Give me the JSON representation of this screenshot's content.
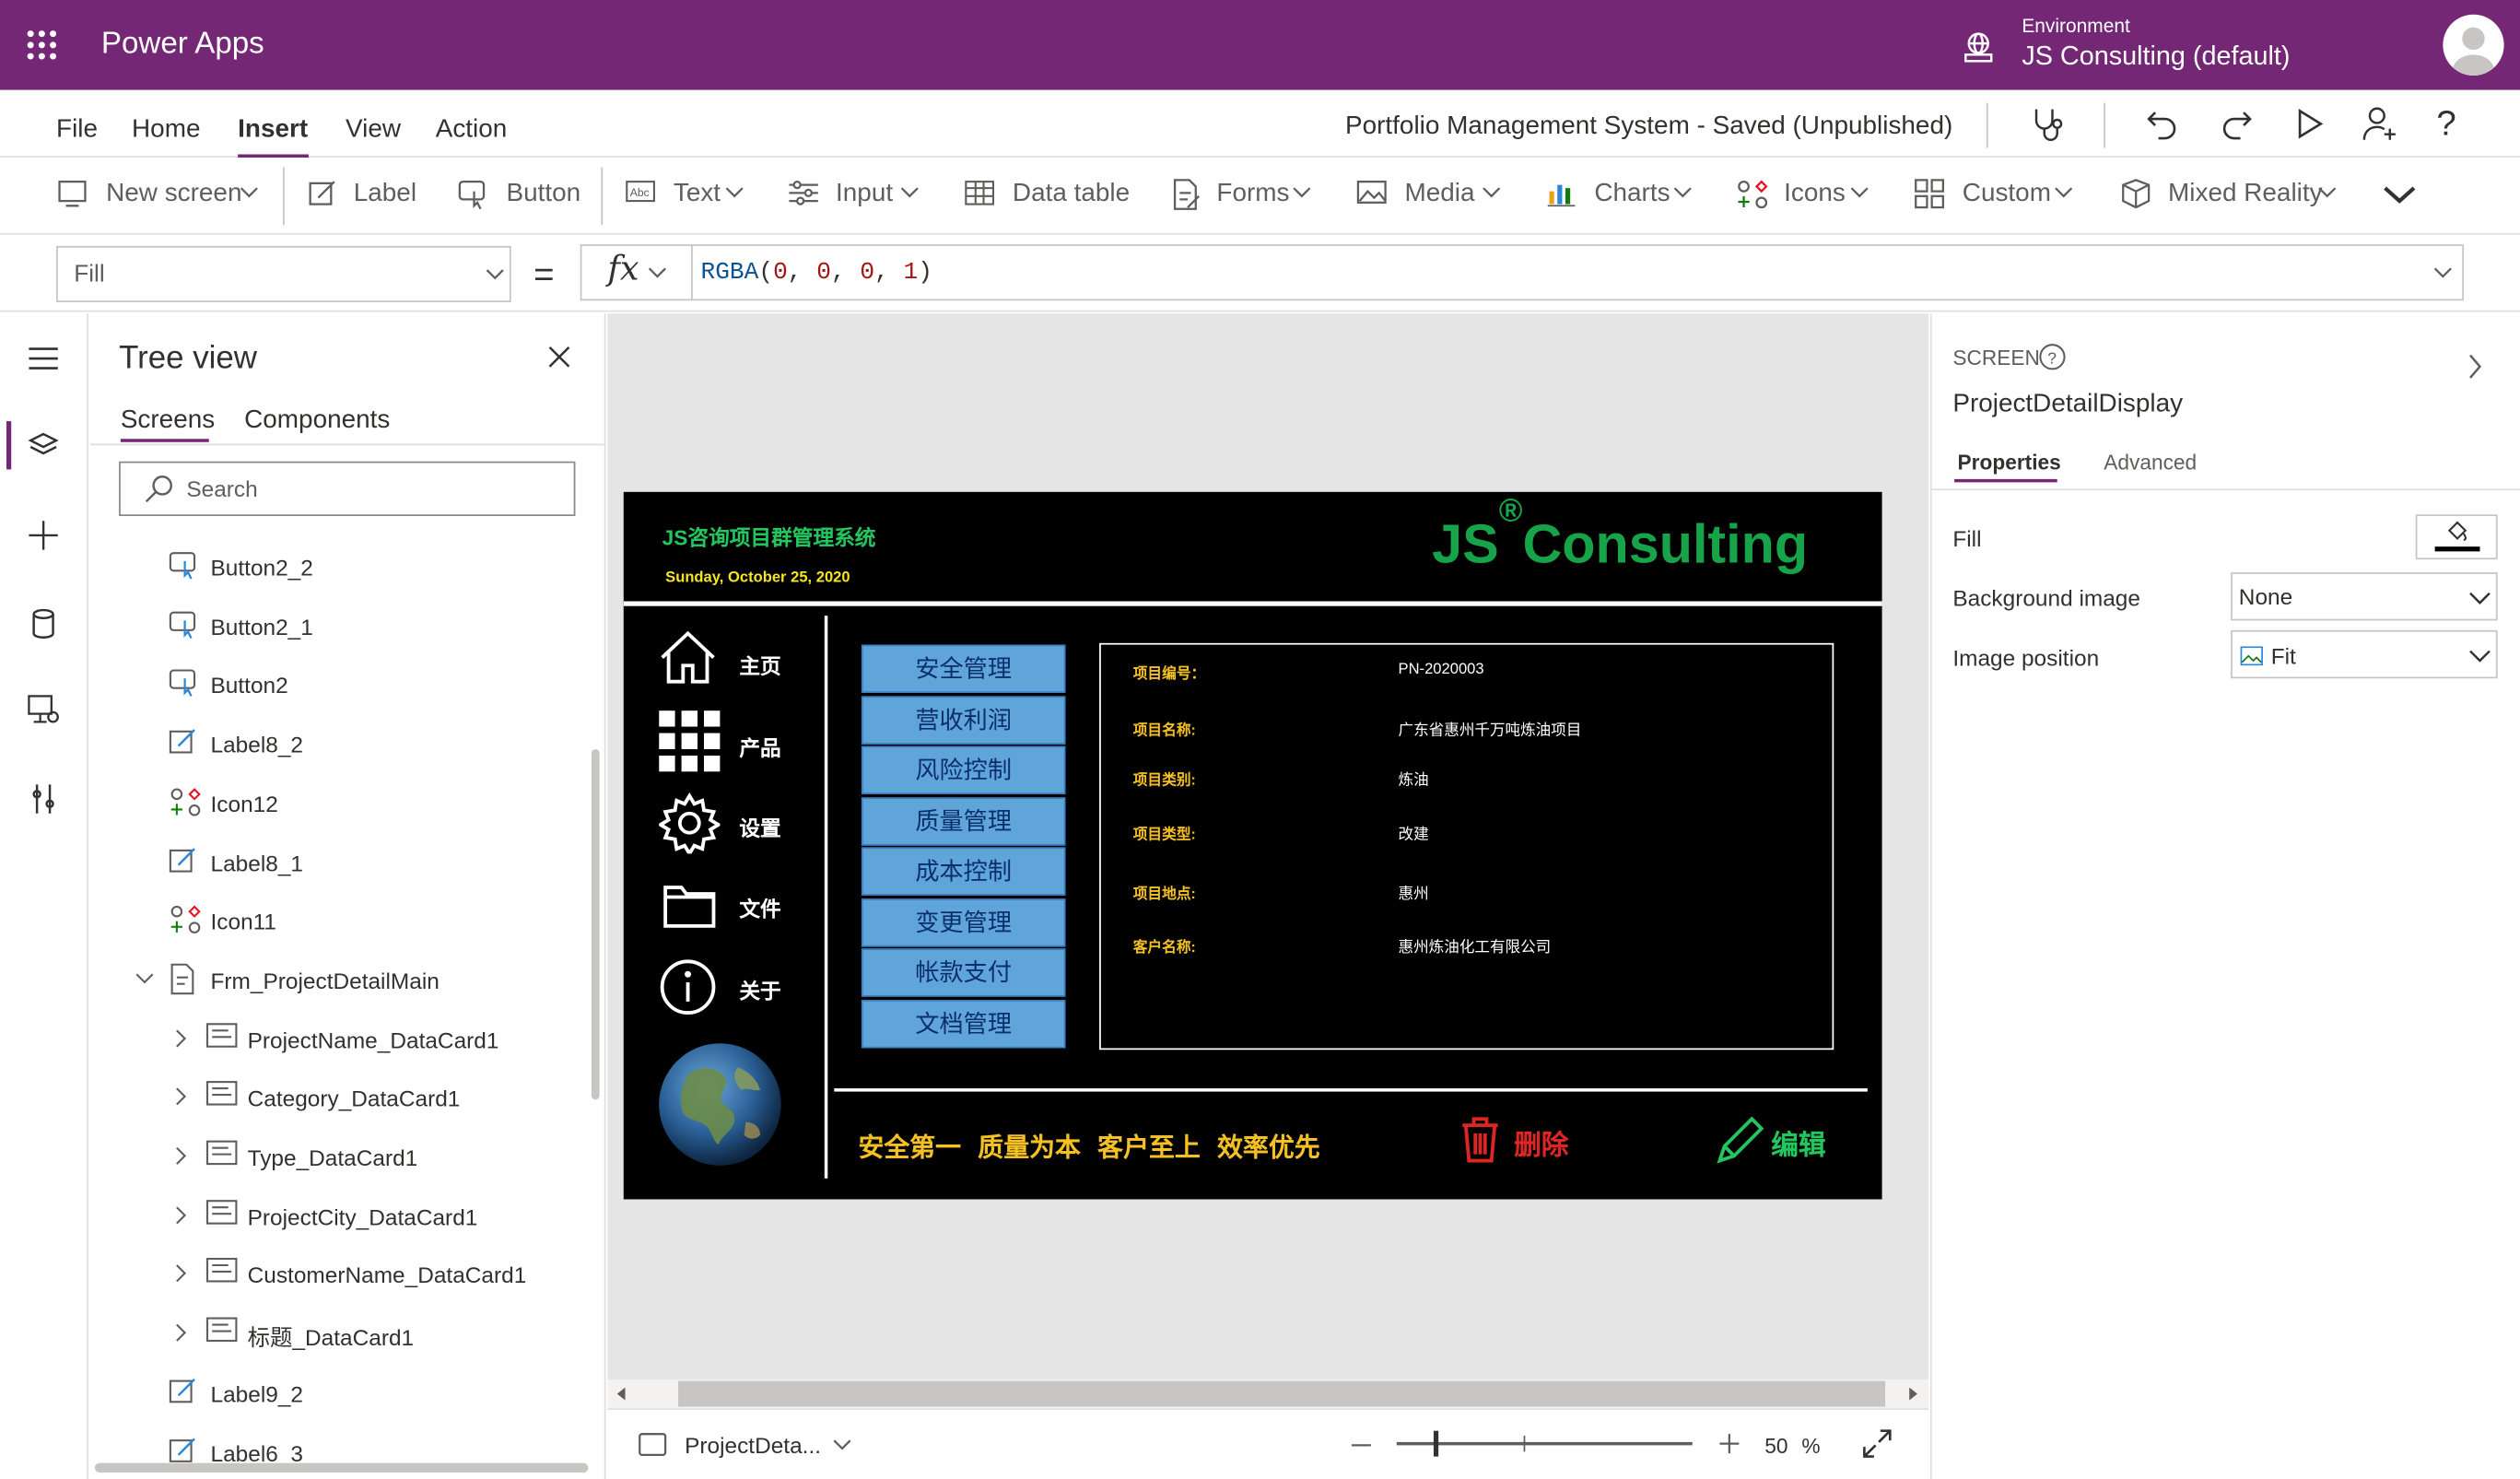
{
  "header": {
    "app_name": "Power Apps",
    "environment_label": "Environment",
    "environment_name": "JS Consulting (default)"
  },
  "menu": {
    "items": [
      "File",
      "Home",
      "Insert",
      "View",
      "Action"
    ],
    "active": "Insert",
    "document_title": "Portfolio Management System - Saved (Unpublished)"
  },
  "ribbon": {
    "new_screen": "New screen",
    "label": "Label",
    "button": "Button",
    "text": "Text",
    "input": "Input",
    "data_table": "Data table",
    "forms": "Forms",
    "media": "Media",
    "charts": "Charts",
    "icons": "Icons",
    "custom": "Custom",
    "mixed_reality": "Mixed Reality"
  },
  "formula_bar": {
    "property": "Fill",
    "equals": "=",
    "fx": "fx",
    "fn": "RGBA",
    "args": [
      "0",
      "0",
      "0",
      "1"
    ]
  },
  "tree_view": {
    "title": "Tree view",
    "tabs": [
      "Screens",
      "Components"
    ],
    "search_placeholder": "Search",
    "items": [
      {
        "label": "Button2_2",
        "icon": "button-icon",
        "indent": 1
      },
      {
        "label": "Button2_1",
        "icon": "button-icon",
        "indent": 1
      },
      {
        "label": "Button2",
        "icon": "button-icon",
        "indent": 1
      },
      {
        "label": "Label8_2",
        "icon": "label-icon",
        "indent": 1
      },
      {
        "label": "Icon12",
        "icon": "icon-control-icon",
        "indent": 1
      },
      {
        "label": "Label8_1",
        "icon": "label-icon",
        "indent": 1
      },
      {
        "label": "Icon11",
        "icon": "icon-control-icon",
        "indent": 1
      },
      {
        "label": "Frm_ProjectDetailMain",
        "icon": "form-icon",
        "indent": 1,
        "expanded": true
      },
      {
        "label": "ProjectName_DataCard1",
        "icon": "datacard-icon",
        "indent": 2
      },
      {
        "label": "Category_DataCard1",
        "icon": "datacard-icon",
        "indent": 2
      },
      {
        "label": "Type_DataCard1",
        "icon": "datacard-icon",
        "indent": 2
      },
      {
        "label": "ProjectCity_DataCard1",
        "icon": "datacard-icon",
        "indent": 2
      },
      {
        "label": "CustomerName_DataCard1",
        "icon": "datacard-icon",
        "indent": 2
      },
      {
        "label": "标题_DataCard1",
        "icon": "datacard-icon",
        "indent": 2
      },
      {
        "label": "Label9_2",
        "icon": "label-icon",
        "indent": 1
      },
      {
        "label": "Label6_3",
        "icon": "label-icon",
        "indent": 1
      }
    ]
  },
  "app_screen": {
    "title": "JS咨询项目群管理系统",
    "date": "Sunday, October 25, 2020",
    "brand": "JS",
    "brand_mark": "®",
    "brand_suffix": "Consulting",
    "nav": [
      {
        "label": "主页",
        "icon": "home-icon"
      },
      {
        "label": "产品",
        "icon": "grid-icon"
      },
      {
        "label": "设置",
        "icon": "gear-icon"
      },
      {
        "label": "文件",
        "icon": "folder-icon"
      },
      {
        "label": "关于",
        "icon": "info-icon"
      }
    ],
    "menu_buttons": [
      "安全管理",
      "营收利润",
      "风险控制",
      "质量管理",
      "成本控制",
      "变更管理",
      "帐款支付",
      "文档管理"
    ],
    "details": [
      {
        "key": "项目编号：",
        "value": "PN-2020003"
      },
      {
        "key": "项目名称:",
        "value": "广东省惠州千万吨炼油项目"
      },
      {
        "key": "项目类别:",
        "value": "炼油"
      },
      {
        "key": "项目类型:",
        "value": "改建"
      },
      {
        "key": "项目地点:",
        "value": "惠州"
      },
      {
        "key": "客户名称:",
        "value": "惠州炼油化工有限公司"
      }
    ],
    "slogan": "安全第一 质量为本 客户至上 效率优先",
    "delete_label": "删除",
    "edit_label": "编辑"
  },
  "status_bar": {
    "screen_name": "ProjectDeta...",
    "zoom": "50",
    "zoom_unit": "%",
    "zoom_fraction": 0.5
  },
  "properties": {
    "type_label": "SCREEN",
    "screen_name": "ProjectDetailDisplay",
    "tabs": [
      "Properties",
      "Advanced"
    ],
    "fill_label": "Fill",
    "fill_color": "#000000",
    "background_image_label": "Background image",
    "background_image_value": "None",
    "image_position_label": "Image position",
    "image_position_value": "Fit"
  },
  "colors": {
    "brand_purple": "#742774",
    "app_green": "#16a34a",
    "app_yellow": "#f5c023",
    "menu_blue": "#60a5d9",
    "delete_red": "#dc2626"
  }
}
